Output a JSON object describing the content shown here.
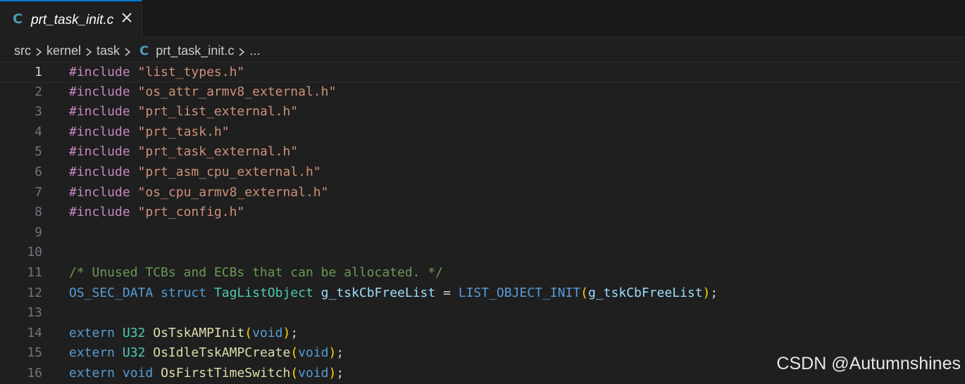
{
  "tab": {
    "icon": "c-file-icon",
    "icon_text": "C",
    "title": "prt_task_init.c"
  },
  "breadcrumb": [
    "src",
    "kernel",
    "task",
    "prt_task_init.c",
    "..."
  ],
  "breadcrumb_icon_text": "C",
  "lines": [
    {
      "n": "1",
      "current": true,
      "tokens": [
        [
          "kw-inc",
          "#include"
        ],
        [
          "plain",
          " "
        ],
        [
          "str",
          "\"list_types.h\""
        ]
      ]
    },
    {
      "n": "2",
      "tokens": [
        [
          "kw-inc",
          "#include"
        ],
        [
          "plain",
          " "
        ],
        [
          "str",
          "\"os_attr_armv8_external.h\""
        ]
      ]
    },
    {
      "n": "3",
      "tokens": [
        [
          "kw-inc",
          "#include"
        ],
        [
          "plain",
          " "
        ],
        [
          "str",
          "\"prt_list_external.h\""
        ]
      ]
    },
    {
      "n": "4",
      "tokens": [
        [
          "kw-inc",
          "#include"
        ],
        [
          "plain",
          " "
        ],
        [
          "str",
          "\"prt_task.h\""
        ]
      ]
    },
    {
      "n": "5",
      "tokens": [
        [
          "kw-inc",
          "#include"
        ],
        [
          "plain",
          " "
        ],
        [
          "str",
          "\"prt_task_external.h\""
        ]
      ]
    },
    {
      "n": "6",
      "tokens": [
        [
          "kw-inc",
          "#include"
        ],
        [
          "plain",
          " "
        ],
        [
          "str",
          "\"prt_asm_cpu_external.h\""
        ]
      ]
    },
    {
      "n": "7",
      "tokens": [
        [
          "kw-inc",
          "#include"
        ],
        [
          "plain",
          " "
        ],
        [
          "str",
          "\"os_cpu_armv8_external.h\""
        ]
      ]
    },
    {
      "n": "8",
      "tokens": [
        [
          "kw-inc",
          "#include"
        ],
        [
          "plain",
          " "
        ],
        [
          "str",
          "\"prt_config.h\""
        ]
      ]
    },
    {
      "n": "9",
      "tokens": []
    },
    {
      "n": "10",
      "tokens": []
    },
    {
      "n": "11",
      "tokens": [
        [
          "cmt",
          "/* Unused TCBs and ECBs that can be allocated. */"
        ]
      ]
    },
    {
      "n": "12",
      "tokens": [
        [
          "mac",
          "OS_SEC_DATA"
        ],
        [
          "plain",
          " "
        ],
        [
          "kw",
          "struct"
        ],
        [
          "plain",
          " "
        ],
        [
          "type",
          "TagListObject"
        ],
        [
          "plain",
          " "
        ],
        [
          "var",
          "g_tskCbFreeList"
        ],
        [
          "plain",
          " = "
        ],
        [
          "mac",
          "LIST_OBJECT_INIT"
        ],
        [
          "paren",
          "("
        ],
        [
          "var",
          "g_tskCbFreeList"
        ],
        [
          "paren",
          ")"
        ],
        [
          "plain",
          ";"
        ]
      ]
    },
    {
      "n": "13",
      "tokens": []
    },
    {
      "n": "14",
      "tokens": [
        [
          "kw",
          "extern"
        ],
        [
          "plain",
          " "
        ],
        [
          "type",
          "U32"
        ],
        [
          "plain",
          " "
        ],
        [
          "fn",
          "OsTskAMPInit"
        ],
        [
          "paren",
          "("
        ],
        [
          "kw",
          "void"
        ],
        [
          "paren",
          ")"
        ],
        [
          "plain",
          ";"
        ]
      ]
    },
    {
      "n": "15",
      "tokens": [
        [
          "kw",
          "extern"
        ],
        [
          "plain",
          " "
        ],
        [
          "type",
          "U32"
        ],
        [
          "plain",
          " "
        ],
        [
          "fn",
          "OsIdleTskAMPCreate"
        ],
        [
          "paren",
          "("
        ],
        [
          "kw",
          "void"
        ],
        [
          "paren",
          ")"
        ],
        [
          "plain",
          ";"
        ]
      ]
    },
    {
      "n": "16",
      "tokens": [
        [
          "kw",
          "extern"
        ],
        [
          "plain",
          " "
        ],
        [
          "kw",
          "void"
        ],
        [
          "plain",
          " "
        ],
        [
          "fn",
          "OsFirstTimeSwitch"
        ],
        [
          "paren",
          "("
        ],
        [
          "kw",
          "void"
        ],
        [
          "paren",
          ")"
        ],
        [
          "plain",
          ";"
        ]
      ]
    }
  ],
  "watermark": "CSDN @Autumnshines"
}
